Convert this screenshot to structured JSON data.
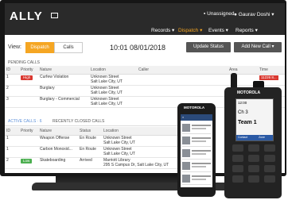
{
  "app": {
    "logo": "ALLY",
    "unassigned_label": "Unassigned",
    "username": "Gaurav Doshi"
  },
  "menu": [
    {
      "label": "Records ▾"
    },
    {
      "label": "Dispatch ▾",
      "active": true
    },
    {
      "label": "Events ▾"
    },
    {
      "label": "Reports ▾"
    }
  ],
  "view": {
    "label": "View:",
    "tabs": [
      "Dispatch",
      "Calls"
    ],
    "selected": "Dispatch",
    "clock": "10:01 08/01/2018",
    "update_button": "Update Status",
    "new_call_button": "Add New Call ▾"
  },
  "pending": {
    "title": "PENDING CALLS",
    "headers": [
      "ID",
      "Priority",
      "Nature",
      "Location",
      "Caller",
      "Area",
      "Time"
    ],
    "rows": [
      {
        "id": "1",
        "priority": "High",
        "nature": "Curfew Violation",
        "loc1": "Unknown Street",
        "loc2": "Salt Lake City, UT",
        "time": "11226 8..."
      },
      {
        "id": "2",
        "priority": "",
        "nature": "Burglary",
        "loc1": "Unknown Street",
        "loc2": "Salt Lake City, UT",
        "time": ""
      },
      {
        "id": "3",
        "priority": "",
        "nature": "Burglary - Commercial",
        "loc1": "Unknown Street",
        "loc2": "Salt Lake City, UT",
        "time": ""
      }
    ]
  },
  "active": {
    "tabs": [
      "ACTIVE CALLS · 6",
      "RECENTLY CLOSED CALLS"
    ],
    "headers": [
      "ID",
      "Priority",
      "Nature",
      "Status",
      "Location"
    ],
    "rows": [
      {
        "id": "1",
        "priority": "",
        "nature": "Weapon Offense",
        "status": "En Route",
        "loc1": "Unknown Street",
        "loc2": "Salt Lake City, UT"
      },
      {
        "id": "1",
        "priority": "",
        "nature": "Carbon Monoxid...",
        "status": "En Route",
        "loc1": "Unknown Street",
        "loc2": "Salt Lake City, UT"
      },
      {
        "id": "2",
        "priority": "Low",
        "nature": "Skateboarding",
        "status": "Arrived",
        "loc1": "Marriott Library",
        "loc2": "295 S Campus Dr, Salt Lake City, UT"
      }
    ]
  },
  "phone": {
    "brand": "MOTOROLA"
  },
  "radio": {
    "brand": "MOTOROLA",
    "time": "12:00",
    "channel": "Ch 3",
    "name": "Team 1",
    "softkeys": [
      "Contact",
      "Zone"
    ]
  },
  "colors": {
    "accent": "#f5a623",
    "topbar": "#2a2a2a",
    "high": "#d9372f",
    "low": "#4caf50"
  }
}
